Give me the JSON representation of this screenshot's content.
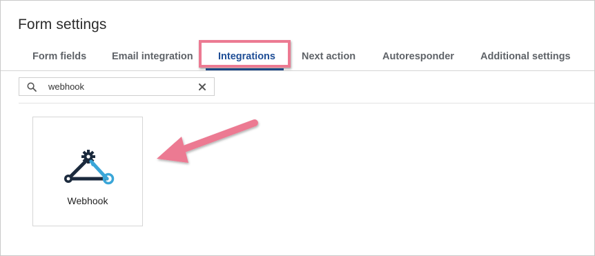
{
  "page": {
    "title": "Form settings"
  },
  "tabs": [
    {
      "label": "Form fields",
      "active": false
    },
    {
      "label": "Email integration",
      "active": false
    },
    {
      "label": "Integrations",
      "active": true
    },
    {
      "label": "Next action",
      "active": false
    },
    {
      "label": "Autoresponder",
      "active": false
    },
    {
      "label": "Additional settings",
      "active": false
    }
  ],
  "search": {
    "value": "webhook",
    "placeholder": "",
    "icon": "search-icon",
    "clear_icon": "close-icon"
  },
  "results": [
    {
      "name": "Webhook",
      "icon": "webhook-icon"
    }
  ],
  "colors": {
    "active_tab": "#1f4e96",
    "highlight": "#ec7a92",
    "logo_dark": "#1b2a3d",
    "logo_light": "#3aa6d8"
  }
}
